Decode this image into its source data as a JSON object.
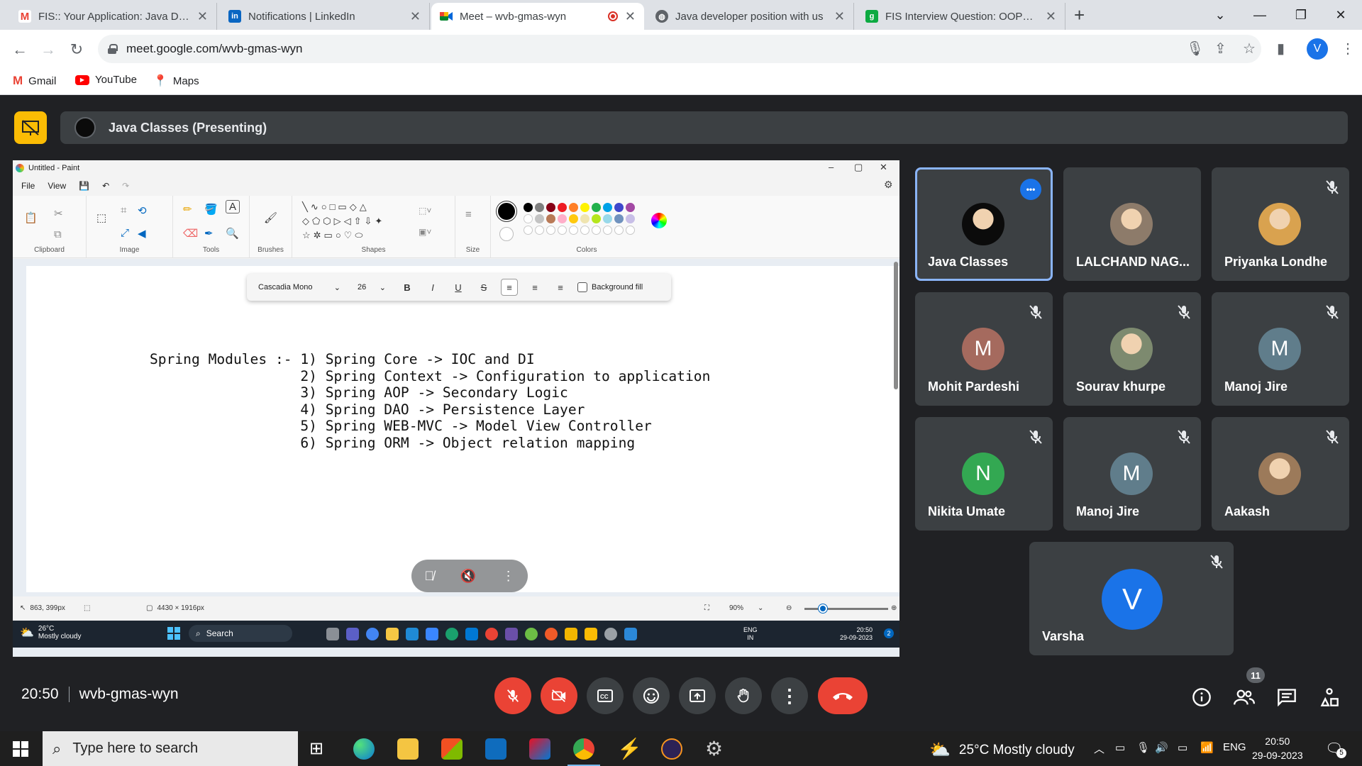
{
  "browser": {
    "tabs": [
      {
        "title": "FIS:: Your Application: Java Deve",
        "favicon": "gmail-icon",
        "active": false
      },
      {
        "title": "Notifications | LinkedIn",
        "favicon": "linkedin-icon",
        "active": false
      },
      {
        "title": "Meet – wvb-gmas-wyn",
        "favicon": "meet-icon",
        "active": true
      },
      {
        "title": "Java developer position with us",
        "favicon": "globe-icon",
        "active": false
      },
      {
        "title": "FIS Interview Question: OOPS co",
        "favicon": "glassdoor-icon",
        "active": false
      }
    ],
    "new_tab_symbol": "+",
    "url": "meet.google.com/wvb-gmas-wyn",
    "profile_initial": "V",
    "bookmarks": [
      {
        "label": "Gmail",
        "icon": "gmail-icon"
      },
      {
        "label": "YouTube",
        "icon": "youtube-icon"
      },
      {
        "label": "Maps",
        "icon": "maps-icon"
      }
    ]
  },
  "meet": {
    "presenting_title": "Java Classes (Presenting)",
    "time": "20:50",
    "meeting_code": "wvb-gmas-wyn",
    "participant_count": "11",
    "participants": [
      {
        "name": "Java Classes",
        "initial": "",
        "color": "#0b0b0b",
        "muted": false,
        "selected": true,
        "avatar": "photo"
      },
      {
        "name": "LALCHAND NAG...",
        "initial": "",
        "color": "#8d7b6a",
        "muted": false,
        "selected": false,
        "avatar": "photo"
      },
      {
        "name": "Priyanka Londhe",
        "initial": "",
        "color": "#d9a24f",
        "muted": true,
        "selected": false,
        "avatar": "photo"
      },
      {
        "name": "Mohit Pardeshi",
        "initial": "M",
        "color": "#a56a5e",
        "muted": true,
        "selected": false,
        "avatar": "letter"
      },
      {
        "name": "Sourav khurpe",
        "initial": "",
        "color": "#7d8a6f",
        "muted": true,
        "selected": false,
        "avatar": "photo"
      },
      {
        "name": "Manoj Jire",
        "initial": "M",
        "color": "#607d8b",
        "muted": true,
        "selected": false,
        "avatar": "letter"
      },
      {
        "name": "Nikita Umate",
        "initial": "N",
        "color": "#33a852",
        "muted": true,
        "selected": false,
        "avatar": "letter"
      },
      {
        "name": "Manoj Jire",
        "initial": "M",
        "color": "#607d8b",
        "muted": true,
        "selected": false,
        "avatar": "letter"
      },
      {
        "name": "Aakash",
        "initial": "",
        "color": "#9c7a5a",
        "muted": true,
        "selected": false,
        "avatar": "photo"
      },
      {
        "name": "Varsha",
        "initial": "V",
        "color": "#1a73e8",
        "muted": true,
        "selected": false,
        "avatar": "letter"
      }
    ]
  },
  "paint": {
    "window_title": "Untitled - Paint",
    "menu": [
      "File",
      "View"
    ],
    "ribbon_groups": [
      "Clipboard",
      "Image",
      "Tools",
      "Brushes",
      "Shapes",
      "Size",
      "Colors"
    ],
    "font_name": "Cascadia Mono",
    "font_size": "26",
    "background_fill_label": "Background fill",
    "canvas_lines": [
      "Spring Modules :- 1) Spring Core -> IOC and DI",
      "                  2) Spring Context -> Configuration to application",
      "                  3) Spring AOP -> Secondary Logic",
      "                  4) Spring DAO -> Persistence Layer",
      "                  5) Spring WEB-MVC -> Model View Controller",
      "                  6) Spring ORM -> Object relation mapping"
    ],
    "status": {
      "cursor_pos": "863, 399px",
      "canvas_size": "4430 × 1916px",
      "zoom": "90%"
    },
    "palette": [
      "#000000",
      "#7f7f7f",
      "#880015",
      "#ed1c24",
      "#ff7f27",
      "#fff200",
      "#22b14c",
      "#00a2e8",
      "#3f48cc",
      "#a349a4",
      "#ffffff",
      "#c3c3c3",
      "#b97a57",
      "#ffaec9",
      "#ffc90e",
      "#efe4b0",
      "#b5e61d",
      "#99d9ea",
      "#7092be",
      "#c8bfe7"
    ],
    "inner_taskbar": {
      "weather_temp": "26°C",
      "weather_desc": "Mostly cloudy",
      "search_label": "Search",
      "lang_top": "ENG",
      "lang_bottom": "IN",
      "time": "20:50",
      "date": "29-09-2023",
      "notif_count": "2"
    }
  },
  "taskbar": {
    "search_placeholder": "Type here to search",
    "weather": "25°C  Mostly cloudy",
    "lang": "ENG",
    "time": "20:50",
    "date": "29-09-2023",
    "notif_count": "5"
  }
}
